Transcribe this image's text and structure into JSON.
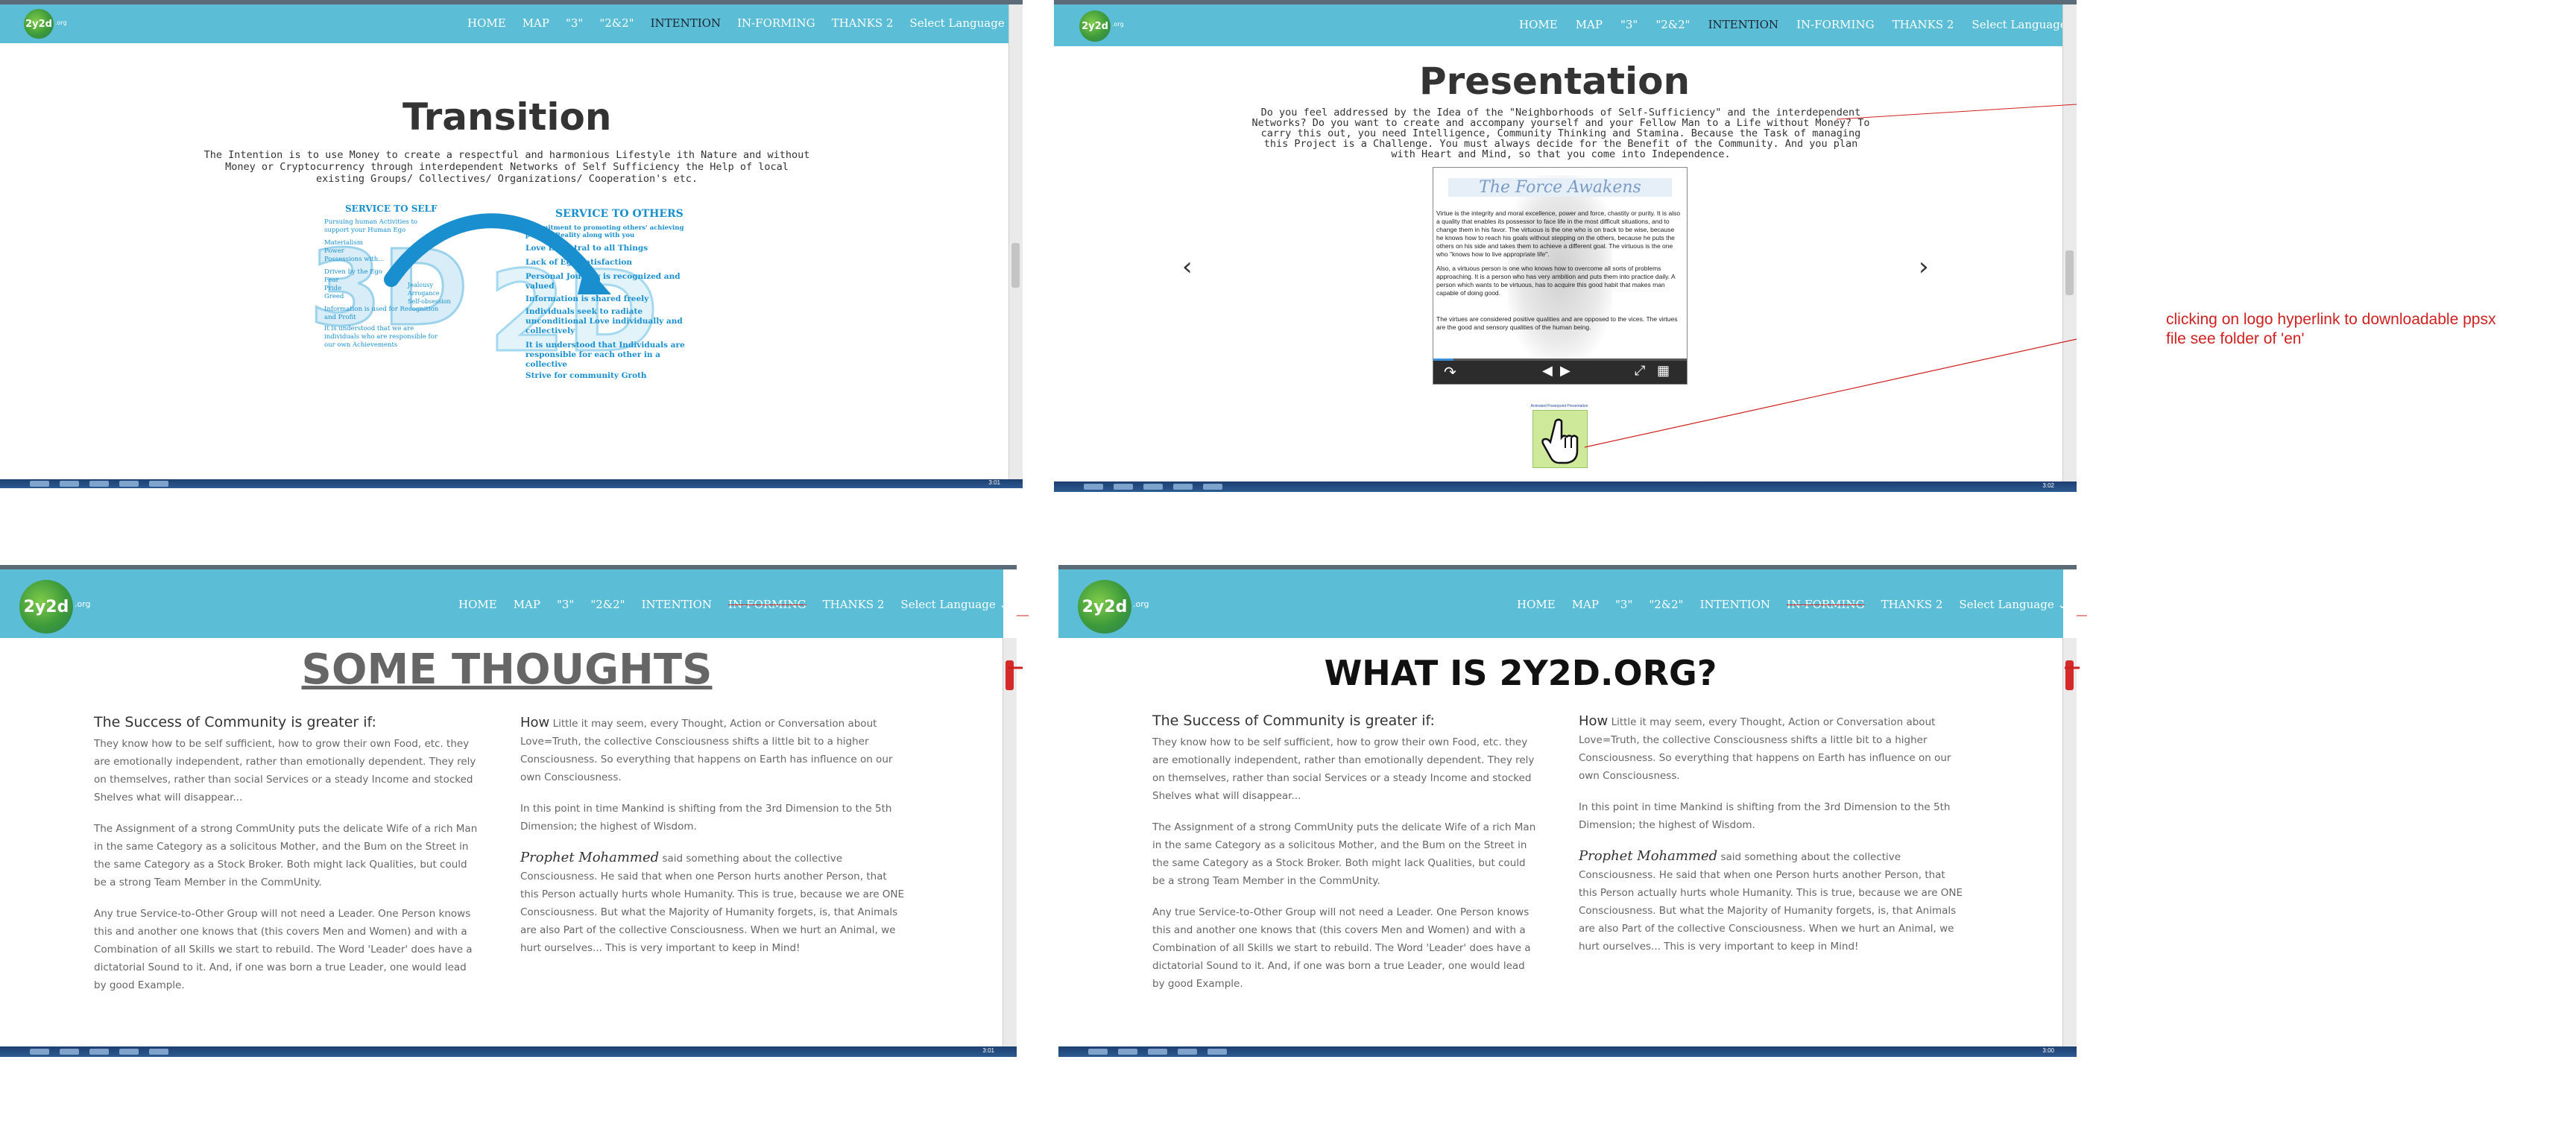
{
  "nav": {
    "logo_text": "2y2d",
    "logo_suffix": ".org",
    "items": [
      "HOME",
      "MAP",
      "\"3\"",
      "\"2&2\"",
      "INTENTION",
      "IN-FORMING",
      "THANKS 2",
      "Select Language"
    ],
    "dropdown_caret": "⌄"
  },
  "panel1": {
    "title": "Transition",
    "intro": "The Intention is to use Money to create a respectful and harmonious Lifestyle ith Nature and without Money or Cryptocurrency through interdependent Networks of Self Sufficiency the Help of local existing Groups/ Collectives/ Organizations/ Cooperation's etc.",
    "diagram": {
      "service_to_self_heading": "SERVICE TO SELF",
      "service_to_self_items": [
        "Pursuing human Activities to support your Human Ego",
        "Materialism",
        "Power",
        "Possessions with...",
        "Driven by the Ego",
        "Fear",
        "Pride",
        "Greed",
        "Information is used for Recognition and Profit",
        "It is understood that we are individuals who are responsible for our own Achievements"
      ],
      "middle_items": [
        "Jealousy",
        "Arrogance",
        "Self-obsession"
      ],
      "service_to_others_heading": "SERVICE TO OTHERS",
      "service_to_others_items": [
        "Commitment to promoting others' achieving positive Reality along with you",
        "Love is central to all Things",
        "Lack of Ego Satisfaction",
        "Personal Journey is recognized and valued",
        "Information is shared freely",
        "Individuals seek to radiate unconditional Love individually and collectively",
        "It is understood that Individuals are responsible for each other in a collective",
        "Strive for community Groth"
      ],
      "watermark": "3D 2D"
    }
  },
  "panel2": {
    "title": "Presentation",
    "intro": "Do you feel addressed by the Idea of the \"Neighborhoods of Self-Sufficiency\" and the interdependent Networks? Do you want to create and accompany yourself and your Fellow Man to a Life without Money? To carry this out, you need Intelligence, Community Thinking and Stamina. Because the Task of managing this Project is a Challenge. You must always decide for the Benefit of the Community. And you plan with Heart and Mind, so that you come into Independence.",
    "slide_title": "The Force Awakens",
    "slide_paragraphs": [
      "Virtue is the integrity and moral excellence, power and force, chastity or purity. It is also a quality that enables its possessor to face life in the most difficult situations, and to change them in his favor. The virtuous is the one who is on track to be wise, because he knows how to reach his goals without stepping on the others, because he puts the others on his side and takes them to achieve a different goal. The virtuous is the one who \"knows how to live appropriate life\".",
      "Also, a virtuous person is one who knows how to overcome all sorts of problems approaching. It is a person who has very ambition and puts them into practice daily. A person which wants to be virtuous, has to acquire this good habit that makes man capable of doing good.",
      "The virtues are considered positive qualities and are opposed to the vices. The virtues are the good and sensory qualities of the human being."
    ],
    "prev_arrow": "‹",
    "next_arrow": "›",
    "player_icons": {
      "share": "↷",
      "prev": "◀",
      "next": "▶",
      "fullscreen": "⤢",
      "grid": "▦"
    },
    "logo_caption": "Animated Powerpoint Presentation",
    "annotation": "clicking on logo hyperlink to downloadable ppsx file see folder of 'en'"
  },
  "panel3": {
    "title": "SOME THOUGHTS"
  },
  "panel4": {
    "title": "WHAT IS 2Y2D.ORG?"
  },
  "article": {
    "left_heading": "The Success of Community is greater if:",
    "left_paragraphs": [
      "They know how to be self sufficient, how to grow their own Food, etc. they are emotionally independent, rather than emotionally dependent. They rely on themselves, rather than social Services or a steady Income and stocked Shelves what will disappear...",
      "The Assignment of a strong CommUnity puts the delicate Wife of a rich Man in the same Category as a solicitous Mother, and the Bum on the Street in the same Category as a Stock Broker. Both might lack Qualities, but could be a strong Team Member in the CommUnity.",
      "Any true Service-to-Other Group will not need a Leader. One Person knows this and another one knows that (this covers Men and Women) and with a Combination of all Skills we start to rebuild. The Word 'Leader' does have a dictatorial Sound to it.  And, if one was born a true Leader, one would lead by good Example."
    ],
    "right_lead": "How",
    "right_first": "Little it may seem, every Thought, Action or Conversation about Love=Truth, the collective Consciousness shifts a little bit to a higher Consciousness. So everything that happens on Earth has influence on our own Consciousness.",
    "right_second": "In this point in time Mankind is shifting from the 3rd Dimension to the 5th Dimension; the highest of Wisdom.",
    "right_prophet": "Prophet Mohammed",
    "right_third": "said something about the collective Consciousness. He said that when one Person hurts another Person, that this Person actually hurts whole Humanity. This is true, because we are ONE Consciousness. But what the Majority of Humanity forgets, is, that Animals are also Part of the collective Consciousness. When we hurt an Animal, we hurt ourselves... This is very important to keep in Mind!"
  },
  "taskbar": {
    "clock1": "3:01",
    "clock2": "3:02",
    "clock3": "3:01",
    "clock4": "3:00"
  }
}
